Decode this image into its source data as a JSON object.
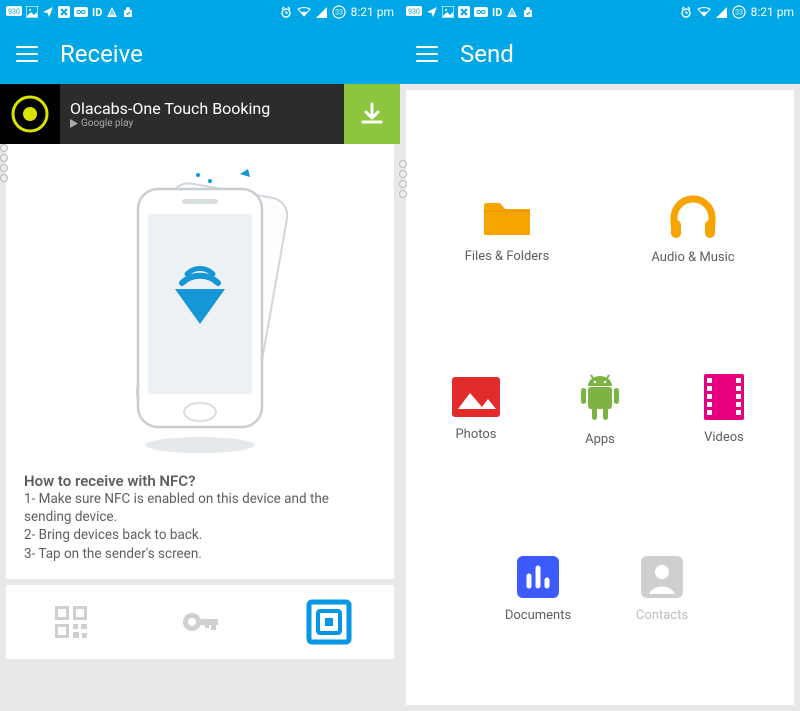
{
  "status": {
    "badge": "930",
    "notif_count": "33",
    "time": "8:21 pm"
  },
  "left": {
    "title": "Receive",
    "ad": {
      "title": "Olacabs-One Touch Booking",
      "store": "Google play"
    },
    "instructions": {
      "title": "How to receive with NFC?",
      "line1": "1- Make sure NFC is enabled on this device and the sending device.",
      "line2": "2- Bring devices back to back.",
      "line3": "3- Tap on the sender's screen."
    },
    "tabs": {
      "qr": "QR",
      "key": "Key",
      "nfc": "NFC"
    }
  },
  "right": {
    "title": "Send",
    "categories": {
      "files": "Files & Folders",
      "audio": "Audio & Music",
      "photos": "Photos",
      "apps": "Apps",
      "videos": "Videos",
      "documents": "Documents",
      "contacts": "Contacts"
    }
  },
  "colors": {
    "primary": "#00a7e6",
    "orange": "#f7a400",
    "red": "#e22b2b",
    "green": "#7cb342",
    "pink": "#e6007e",
    "blue": "#3d5afe",
    "grey": "#bcbcbc"
  }
}
